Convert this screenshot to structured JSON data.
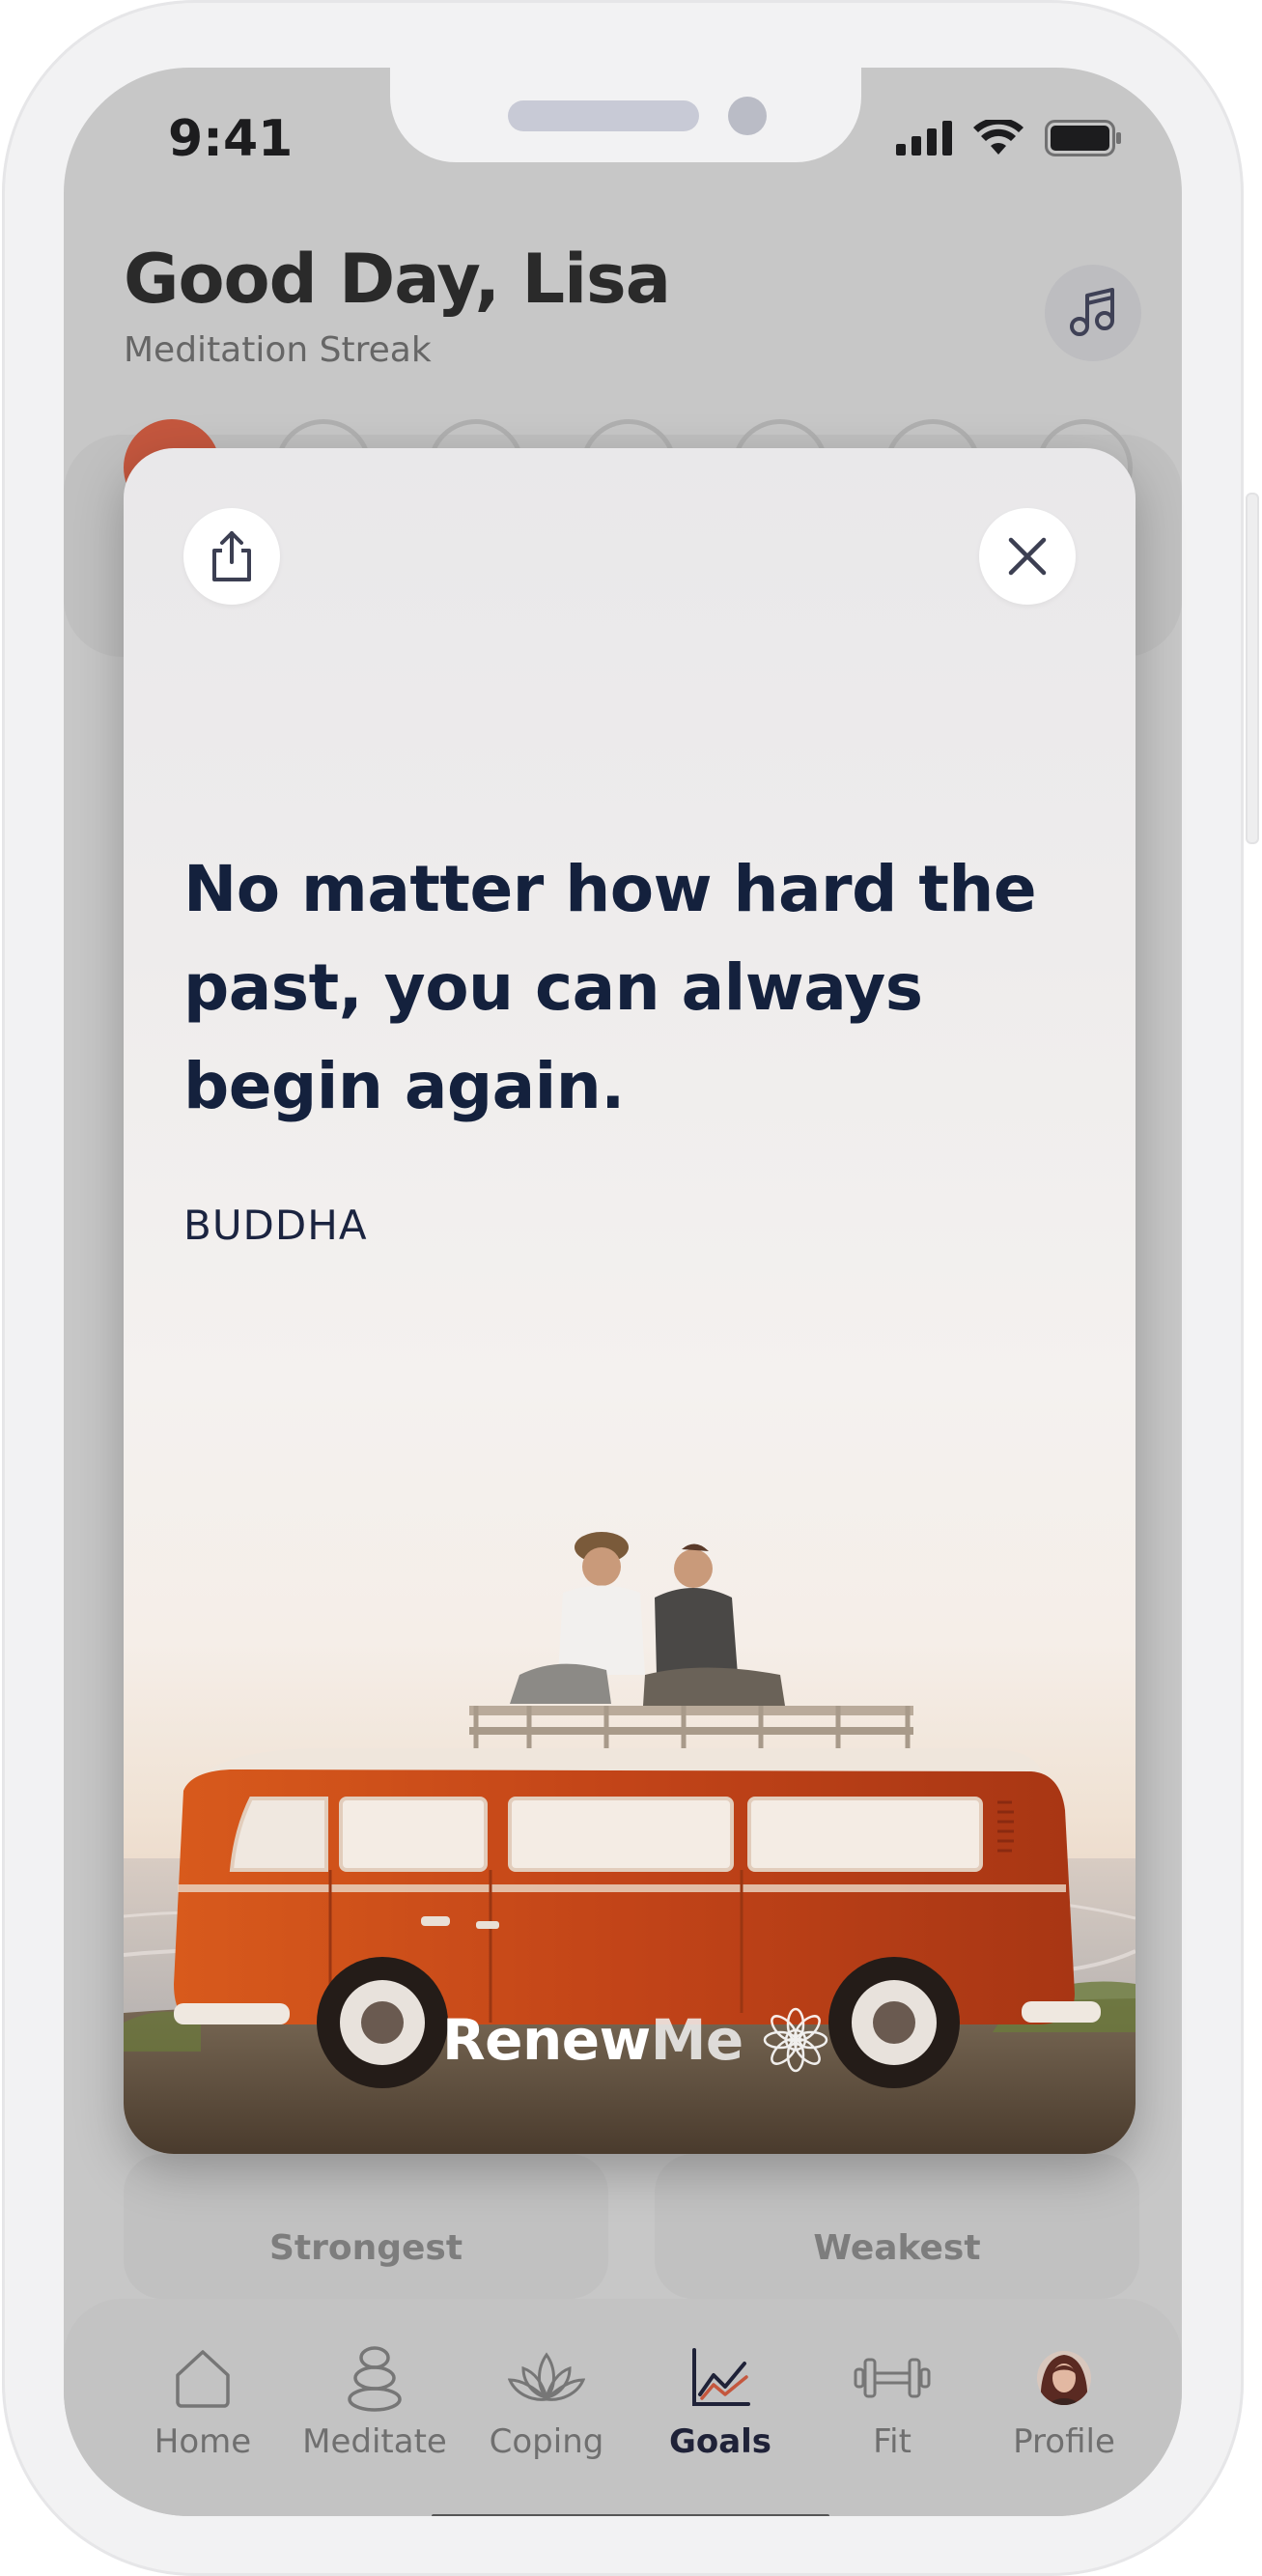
{
  "status_bar": {
    "time": "9:41"
  },
  "header": {
    "greeting": "Good Day, Lisa",
    "subtitle": "Meditation Streak"
  },
  "streak": {
    "days_total": 7,
    "days_completed": 1
  },
  "stats": {
    "strongest_label": "Strongest",
    "weakest_label": "Weakest"
  },
  "quote_card": {
    "quote": "No matter how hard the past, you can always begin again.",
    "author": "BUDDHA",
    "brand_bold": "Renew",
    "brand_light": "Me"
  },
  "tabs": [
    {
      "label": "Home",
      "icon": "home-icon",
      "active": false
    },
    {
      "label": "Meditate",
      "icon": "meditate-icon",
      "active": false
    },
    {
      "label": "Coping",
      "icon": "lotus-icon",
      "active": false
    },
    {
      "label": "Goals",
      "icon": "chart-icon",
      "active": true
    },
    {
      "label": "Fit",
      "icon": "dumbbell-icon",
      "active": false
    },
    {
      "label": "Profile",
      "icon": "avatar",
      "active": false
    }
  ],
  "colors": {
    "accent": "#c4573e",
    "quote_text": "#14213d",
    "van": "#c2441a",
    "screen_dim": "#c7c7c7"
  }
}
